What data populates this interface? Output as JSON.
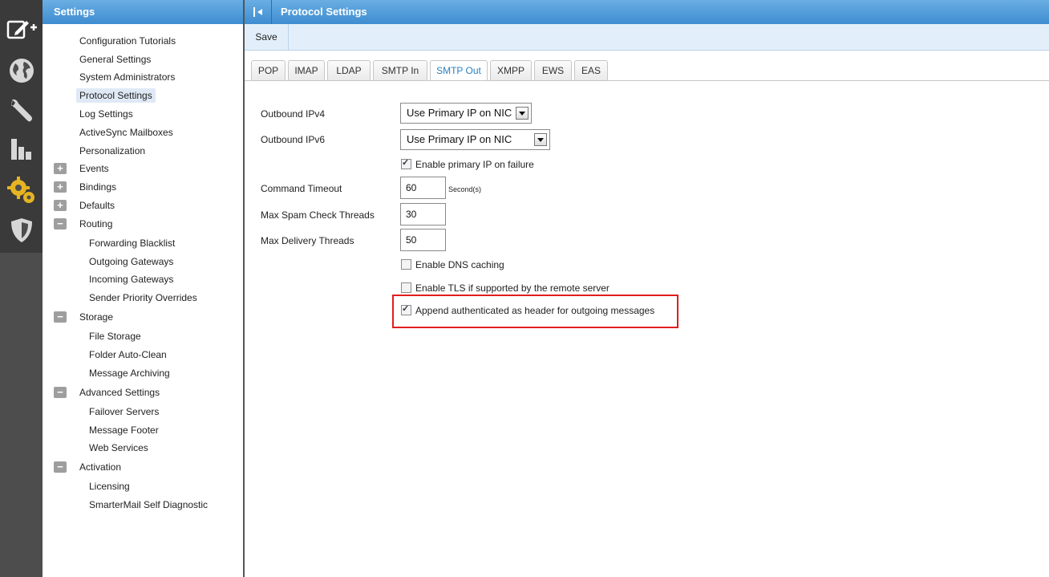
{
  "rail": {
    "icons": [
      "compose-icon",
      "globe-icon",
      "wrench-icon",
      "reports-icon",
      "settings-gear-icon",
      "security-shield-icon"
    ]
  },
  "tree": {
    "title": "Settings",
    "items": [
      {
        "label": "Configuration Tutorials"
      },
      {
        "label": "General Settings"
      },
      {
        "label": "System Administrators"
      },
      {
        "label": "Protocol Settings",
        "selected": true
      },
      {
        "label": "Log Settings"
      },
      {
        "label": "ActiveSync Mailboxes"
      },
      {
        "label": "Personalization"
      }
    ],
    "groups": {
      "events": {
        "label": "Events",
        "toggle": "+"
      },
      "bindings": {
        "label": "Bindings",
        "toggle": "+"
      },
      "defaults": {
        "label": "Defaults",
        "toggle": "+"
      },
      "routing": {
        "label": "Routing",
        "toggle": "−",
        "children": [
          "Forwarding Blacklist",
          "Outgoing Gateways",
          "Incoming Gateways",
          "Sender Priority Overrides"
        ]
      },
      "storage": {
        "label": "Storage",
        "toggle": "−",
        "children": [
          "File Storage",
          "Folder Auto-Clean",
          "Message Archiving"
        ]
      },
      "advanced": {
        "label": "Advanced Settings",
        "toggle": "−",
        "children": [
          "Failover Servers",
          "Message Footer",
          "Web Services"
        ]
      },
      "activation": {
        "label": "Activation",
        "toggle": "−",
        "children": [
          "Licensing",
          "SmarterMail Self Diagnostic"
        ]
      }
    }
  },
  "main": {
    "title": "Protocol Settings",
    "toolbar": {
      "save_label": "Save"
    },
    "tabs": [
      "POP",
      "IMAP",
      "LDAP",
      "SMTP In",
      "SMTP Out",
      "XMPP",
      "EWS",
      "EAS"
    ],
    "active_tab": "SMTP Out",
    "form": {
      "outbound_ipv4": {
        "label": "Outbound IPv4",
        "value": "Use Primary IP on NIC"
      },
      "outbound_ipv6": {
        "label": "Outbound IPv6",
        "value": "Use Primary IP on NIC"
      },
      "enable_primary_ip": {
        "label": "Enable primary IP on failure",
        "checked": true
      },
      "command_timeout": {
        "label": "Command Timeout",
        "value": "60",
        "unit": "Second(s)"
      },
      "max_spam_threads": {
        "label": "Max Spam Check Threads",
        "value": "30"
      },
      "max_delivery_threads": {
        "label": "Max Delivery Threads",
        "value": "50"
      },
      "enable_dns_caching": {
        "label": "Enable DNS caching",
        "checked": false
      },
      "enable_tls": {
        "label": "Enable TLS if supported by the remote server",
        "checked": false
      },
      "append_authenticated": {
        "label": "Append authenticated as header for outgoing messages",
        "checked": true
      }
    }
  },
  "colors": {
    "header_blue": "#3e8dd0",
    "highlight_red": "#e01e1e",
    "active_tab_text": "#2a7fbf"
  }
}
